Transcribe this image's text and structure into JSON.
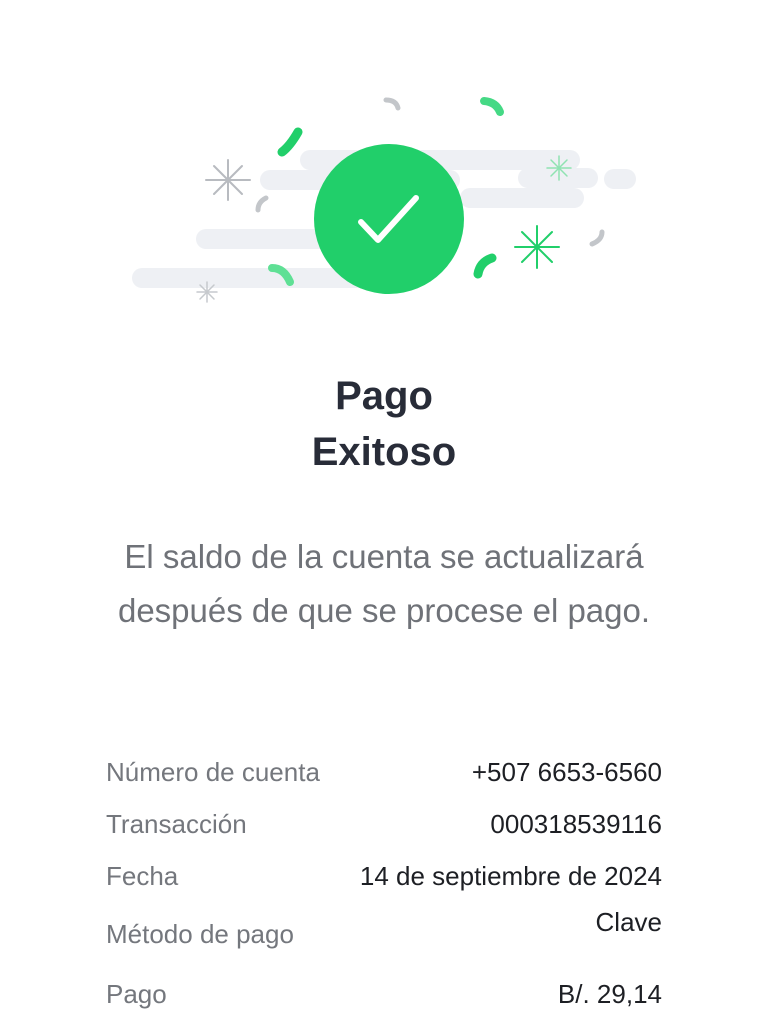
{
  "status": {
    "title_line1": "Pago",
    "title_line2": "Exitoso",
    "message": "El saldo de la cuenta se actualizará después de que se procese el pago.",
    "success_color": "#21cf6a"
  },
  "details": {
    "account_label": "Número de cuenta",
    "account_value": "+507 6653-6560",
    "transaction_label": "Transacción",
    "transaction_value": "000318539116",
    "date_label": "Fecha",
    "date_value": "14 de septiembre de 2024",
    "method_label": "Método de pago",
    "method_value": "Clave",
    "amount_label": "Pago",
    "amount_value": "B/. 29,14"
  },
  "icons": {
    "main": "check-circle-icon",
    "decoration": [
      "confetti-icon",
      "sparkle-icon"
    ]
  }
}
